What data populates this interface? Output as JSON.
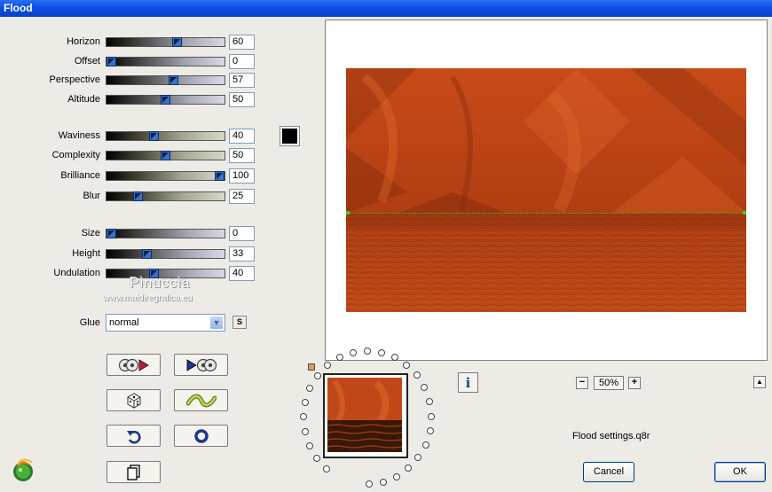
{
  "window": {
    "title": "Flood"
  },
  "sliders_group1": [
    {
      "label": "Horizon",
      "value": "60",
      "pos": 0.6
    },
    {
      "label": "Offset",
      "value": "0",
      "pos": 0.0
    },
    {
      "label": "Perspective",
      "value": "57",
      "pos": 0.57
    },
    {
      "label": "Altitude",
      "value": "50",
      "pos": 0.5
    }
  ],
  "sliders_group2": [
    {
      "label": "Waviness",
      "value": "40",
      "pos": 0.4
    },
    {
      "label": "Complexity",
      "value": "50",
      "pos": 0.5
    },
    {
      "label": "Brilliance",
      "value": "100",
      "pos": 1.0
    },
    {
      "label": "Blur",
      "value": "25",
      "pos": 0.25
    }
  ],
  "sliders_group3": [
    {
      "label": "Size",
      "value": "0",
      "pos": 0.0
    },
    {
      "label": "Height",
      "value": "33",
      "pos": 0.33
    },
    {
      "label": "Undulation",
      "value": "40",
      "pos": 0.4
    }
  ],
  "color_swatch": "#000000",
  "watermark": {
    "name": "Pinuccia",
    "url": "www.maidiregrafica.eu"
  },
  "glue": {
    "label": "Glue",
    "value": "normal",
    "s_button": "S"
  },
  "zoom": {
    "value": "50%",
    "minus": "−",
    "plus": "+"
  },
  "info_button": "i",
  "settings_file": "Flood settings.q8r",
  "buttons": {
    "cancel": "Cancel",
    "ok": "OK"
  },
  "colors": {
    "accent_orange": "#c4501a",
    "titlebar": "#0a4fe0"
  }
}
